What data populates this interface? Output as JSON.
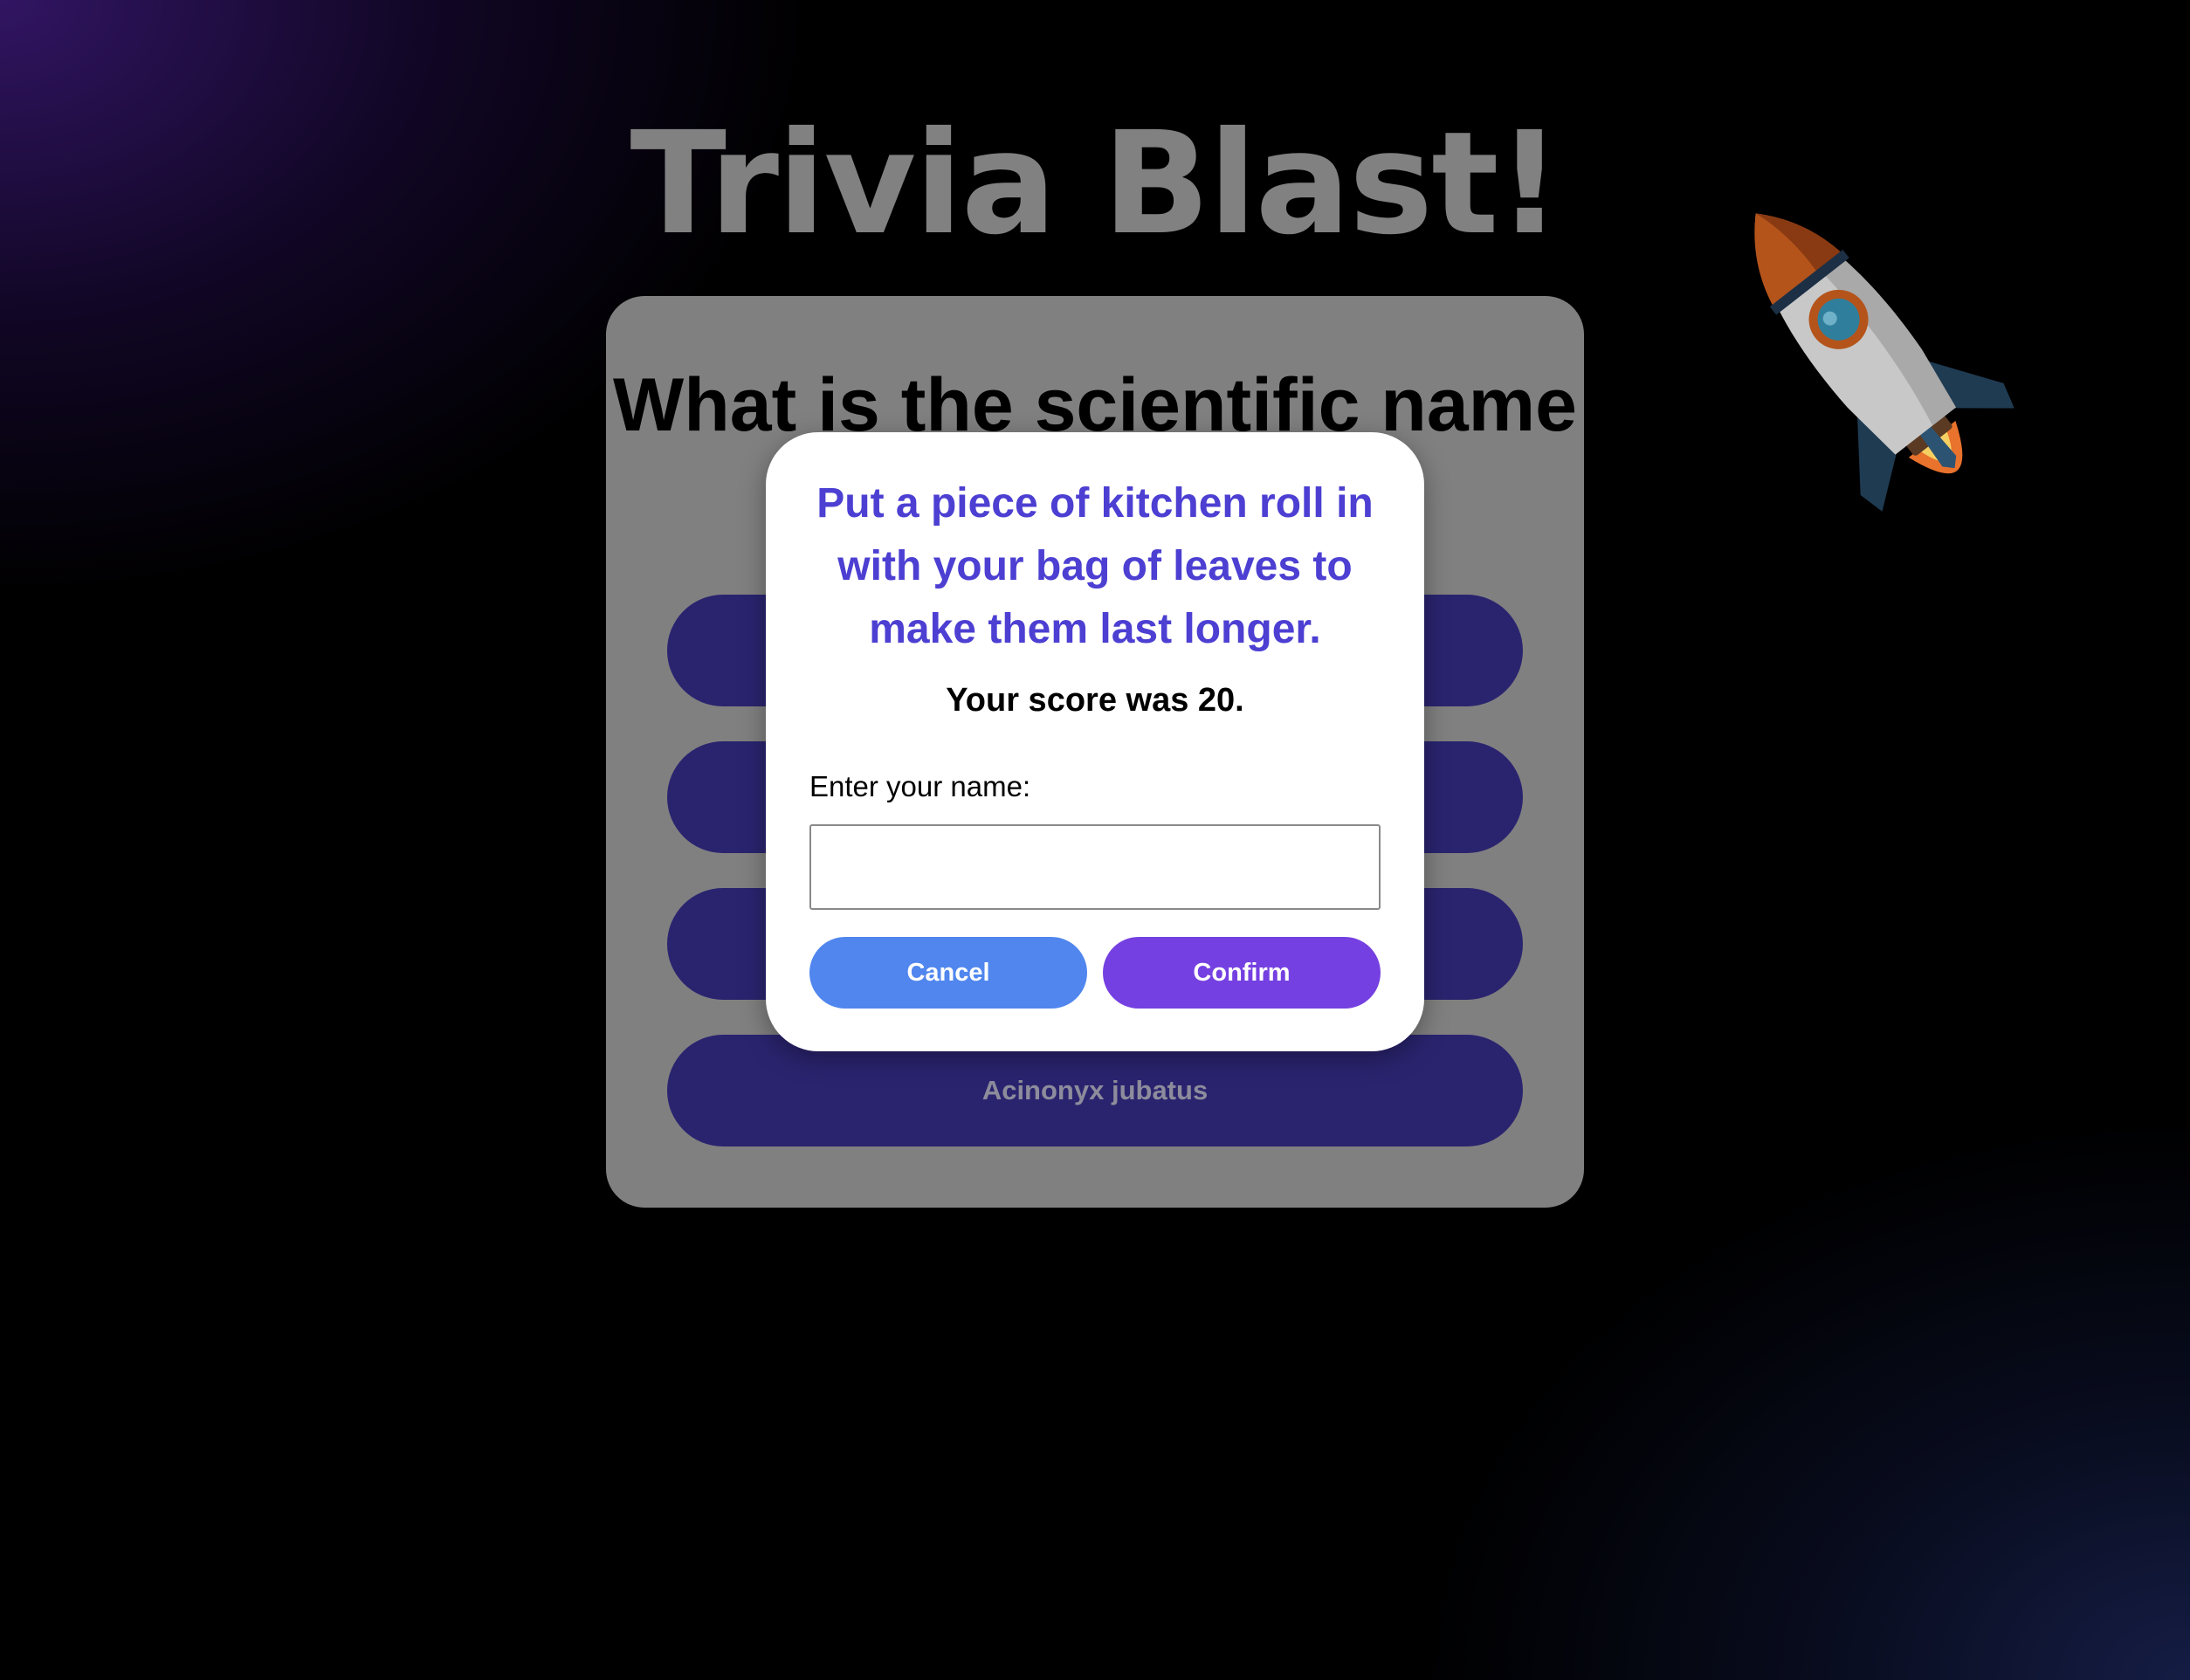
{
  "app": {
    "title": "Trivia Blast!"
  },
  "quiz": {
    "question": "What is the scientific name of the cheetah?",
    "answers": [
      "",
      "",
      "",
      "Acinonyx jubatus"
    ]
  },
  "modal": {
    "fact": "Put a piece of kitchen roll in with your bag of leaves to make them last longer.",
    "score_text": "Your score was 20.",
    "name_label": "Enter your name:",
    "name_value": "",
    "cancel_label": "Cancel",
    "confirm_label": "Confirm"
  },
  "icons": {
    "decoration": "rocket-icon"
  },
  "colors": {
    "card": "#808080",
    "answer_button": "#2a246f",
    "fact_text": "#4c3fd2",
    "cancel_button": "#5086ee",
    "confirm_button": "#7540e1"
  }
}
